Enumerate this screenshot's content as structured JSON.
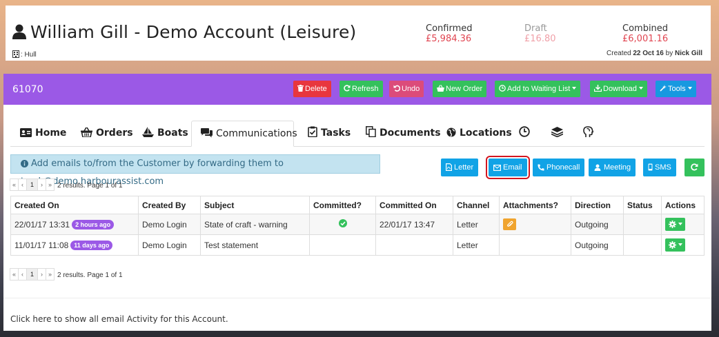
{
  "header": {
    "account_title": "William Gill - Demo Account (Leisure)",
    "location": ": Hull",
    "confirmed_label": "Confirmed",
    "confirmed_value": "£5,984.36",
    "draft_label": "Draft",
    "draft_value": "£16.80",
    "combined_label": "Combined",
    "combined_value": "£6,001.16",
    "created_prefix": "Created",
    "created_date": "22 Oct 16",
    "created_by_word": "by",
    "created_by": "Nick Gill"
  },
  "toolbar": {
    "account_number": "61070",
    "delete_label": "Delete",
    "refresh_label": "Refresh",
    "undo_label": "Undo",
    "new_order_label": "New Order",
    "waiting_list_label": "Add to Waiting List",
    "download_label": "Download",
    "tools_label": "Tools"
  },
  "tabs": [
    {
      "label": "Home"
    },
    {
      "label": "Orders"
    },
    {
      "label": "Boats"
    },
    {
      "label": "Communications"
    },
    {
      "label": "Tasks"
    },
    {
      "label": "Documents"
    },
    {
      "label": "Locations"
    }
  ],
  "info_text": "Add emails to/from the Customer by forwarding them to track@demo.harbourassist.com",
  "actions": {
    "letter": "Letter",
    "email": "Email",
    "phonecall": "Phonecall",
    "meeting": "Meeting",
    "sms": "SMS"
  },
  "pagination": {
    "first": "«",
    "prev": "‹",
    "page": "1",
    "next": "›",
    "last": "»",
    "summary": "2 results. Page 1 of 1"
  },
  "table": {
    "headers": [
      "Created On",
      "Created By",
      "Subject",
      "Committed?",
      "Committed On",
      "Channel",
      "Attachments?",
      "Direction",
      "Status",
      "Actions"
    ],
    "rows": [
      {
        "created_on": "22/01/17 13:31",
        "age": "2 hours ago",
        "created_by": "Demo Login",
        "subject": "State of craft - warning",
        "committed": true,
        "committed_on": "22/01/17 13:47",
        "channel": "Letter",
        "attachments": true,
        "direction": "Outgoing",
        "status": ""
      },
      {
        "created_on": "11/01/17 11:08",
        "age": "11 days ago",
        "created_by": "Demo Login",
        "subject": "Test statement",
        "committed": false,
        "committed_on": "",
        "channel": "Letter",
        "attachments": false,
        "direction": "Outgoing",
        "status": ""
      }
    ]
  },
  "footer_link": "Click here to show all email Activity for this Account.",
  "colors": {
    "toolbar_bg": "#9b59e6",
    "danger": "#e8363e",
    "success": "#34c15c",
    "info": "#11a3e6",
    "money_red": "#e04450",
    "highlight": "#d3151f"
  }
}
